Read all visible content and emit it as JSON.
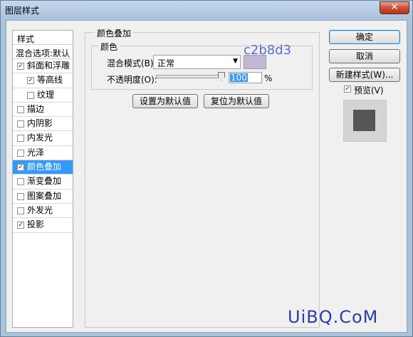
{
  "window": {
    "title": "图层样式",
    "close_label": "✕"
  },
  "style_list": {
    "header": "样式",
    "blend": "混合选项:默认",
    "items": [
      {
        "label": "斜面和浮雕",
        "checked": "✓",
        "indent": false,
        "selected": false
      },
      {
        "label": "等高线",
        "checked": "✓",
        "indent": true,
        "selected": false
      },
      {
        "label": "纹理",
        "checked": "",
        "indent": true,
        "selected": false
      },
      {
        "label": "描边",
        "checked": "",
        "indent": false,
        "selected": false
      },
      {
        "label": "内阴影",
        "checked": "",
        "indent": false,
        "selected": false
      },
      {
        "label": "内发光",
        "checked": "",
        "indent": false,
        "selected": false
      },
      {
        "label": "光泽",
        "checked": "",
        "indent": false,
        "selected": false
      },
      {
        "label": "颜色叠加",
        "checked": "✓",
        "indent": false,
        "selected": true
      },
      {
        "label": "渐变叠加",
        "checked": "",
        "indent": false,
        "selected": false
      },
      {
        "label": "图案叠加",
        "checked": "",
        "indent": false,
        "selected": false
      },
      {
        "label": "外发光",
        "checked": "",
        "indent": false,
        "selected": false
      },
      {
        "label": "投影",
        "checked": "✓",
        "indent": false,
        "selected": false
      }
    ]
  },
  "panel": {
    "title": "颜色叠加",
    "group_title": "颜色",
    "blend_mode_label": "混合模式(B):",
    "blend_mode_value": "正常",
    "swatch_color": "#c2b8d3",
    "hex_annotation": "c2b8d3",
    "opacity_label": "不透明度(O):",
    "opacity_value": "100",
    "opacity_unit": "%",
    "opacity_level": 1.0,
    "set_default_label": "设置为默认值",
    "reset_default_label": "复位为默认值"
  },
  "buttons": {
    "ok": "确定",
    "cancel": "取消",
    "new_style": "新建样式(W)...",
    "preview_label": "预览(V)",
    "preview_checked": "✓"
  },
  "watermark": "UiBQ.CoM"
}
